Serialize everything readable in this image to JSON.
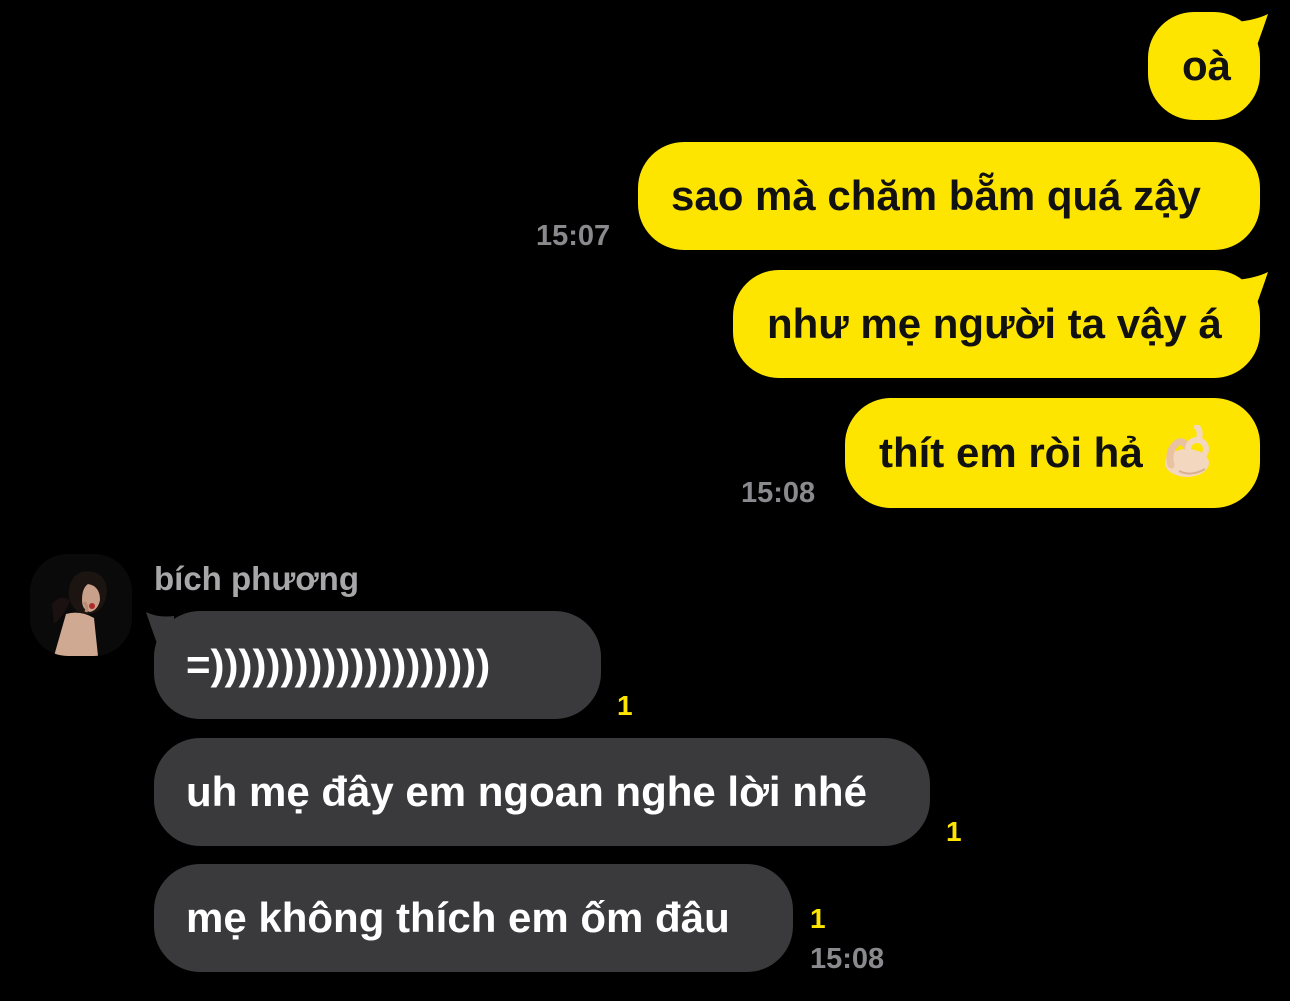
{
  "colors": {
    "background": "#000000",
    "outgoing_bubble": "#FEE500",
    "incoming_bubble": "#3A3A3C",
    "unread_count": "#FEE500",
    "timestamp": "#8A8A8E"
  },
  "messages_out": [
    {
      "text": "oà"
    },
    {
      "text": "sao mà chăm bẵm quá zậy",
      "time": "15:07"
    },
    {
      "text": "như mẹ người ta vậy á"
    },
    {
      "text": "thít em ròi hả",
      "emoji": "ok-hand-icon",
      "time": "15:08"
    }
  ],
  "contact": {
    "name": "bích phương",
    "avatar": "profile-photo"
  },
  "messages_in": [
    {
      "text": "=))))))))))))))))))))",
      "unread": "1"
    },
    {
      "text": "uh mẹ đây em ngoan nghe lời nhé",
      "unread": "1"
    },
    {
      "text": "mẹ không thích em ốm đâu",
      "unread": "1",
      "time": "15:08"
    }
  ]
}
